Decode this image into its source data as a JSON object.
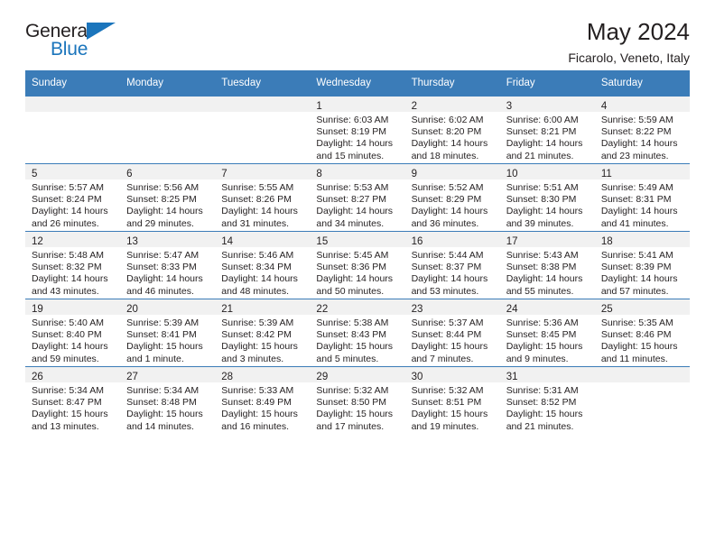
{
  "brand": {
    "word_one": "General",
    "word_two": "Blue",
    "flag_icon": "blue-triangle-flag",
    "accent_color": "#1b75bc"
  },
  "header": {
    "title": "May 2024",
    "location": "Ficarolo, Veneto, Italy"
  },
  "theme": {
    "header_blue": "#3b7cb8",
    "daynum_band": "#f1f1f1",
    "text": "#231f20"
  },
  "calendar": {
    "weekday_headers": [
      "Sunday",
      "Monday",
      "Tuesday",
      "Wednesday",
      "Thursday",
      "Friday",
      "Saturday"
    ],
    "labels": {
      "sunrise": "Sunrise:",
      "sunset": "Sunset:",
      "daylight": "Daylight:"
    },
    "weeks": [
      [
        {
          "day": ""
        },
        {
          "day": ""
        },
        {
          "day": ""
        },
        {
          "day": "1",
          "sunrise": "Sunrise: 6:03 AM",
          "sunset": "Sunset: 8:19 PM",
          "daylight1": "Daylight: 14 hours",
          "daylight2": "and 15 minutes."
        },
        {
          "day": "2",
          "sunrise": "Sunrise: 6:02 AM",
          "sunset": "Sunset: 8:20 PM",
          "daylight1": "Daylight: 14 hours",
          "daylight2": "and 18 minutes."
        },
        {
          "day": "3",
          "sunrise": "Sunrise: 6:00 AM",
          "sunset": "Sunset: 8:21 PM",
          "daylight1": "Daylight: 14 hours",
          "daylight2": "and 21 minutes."
        },
        {
          "day": "4",
          "sunrise": "Sunrise: 5:59 AM",
          "sunset": "Sunset: 8:22 PM",
          "daylight1": "Daylight: 14 hours",
          "daylight2": "and 23 minutes."
        }
      ],
      [
        {
          "day": "5",
          "sunrise": "Sunrise: 5:57 AM",
          "sunset": "Sunset: 8:24 PM",
          "daylight1": "Daylight: 14 hours",
          "daylight2": "and 26 minutes."
        },
        {
          "day": "6",
          "sunrise": "Sunrise: 5:56 AM",
          "sunset": "Sunset: 8:25 PM",
          "daylight1": "Daylight: 14 hours",
          "daylight2": "and 29 minutes."
        },
        {
          "day": "7",
          "sunrise": "Sunrise: 5:55 AM",
          "sunset": "Sunset: 8:26 PM",
          "daylight1": "Daylight: 14 hours",
          "daylight2": "and 31 minutes."
        },
        {
          "day": "8",
          "sunrise": "Sunrise: 5:53 AM",
          "sunset": "Sunset: 8:27 PM",
          "daylight1": "Daylight: 14 hours",
          "daylight2": "and 34 minutes."
        },
        {
          "day": "9",
          "sunrise": "Sunrise: 5:52 AM",
          "sunset": "Sunset: 8:29 PM",
          "daylight1": "Daylight: 14 hours",
          "daylight2": "and 36 minutes."
        },
        {
          "day": "10",
          "sunrise": "Sunrise: 5:51 AM",
          "sunset": "Sunset: 8:30 PM",
          "daylight1": "Daylight: 14 hours",
          "daylight2": "and 39 minutes."
        },
        {
          "day": "11",
          "sunrise": "Sunrise: 5:49 AM",
          "sunset": "Sunset: 8:31 PM",
          "daylight1": "Daylight: 14 hours",
          "daylight2": "and 41 minutes."
        }
      ],
      [
        {
          "day": "12",
          "sunrise": "Sunrise: 5:48 AM",
          "sunset": "Sunset: 8:32 PM",
          "daylight1": "Daylight: 14 hours",
          "daylight2": "and 43 minutes."
        },
        {
          "day": "13",
          "sunrise": "Sunrise: 5:47 AM",
          "sunset": "Sunset: 8:33 PM",
          "daylight1": "Daylight: 14 hours",
          "daylight2": "and 46 minutes."
        },
        {
          "day": "14",
          "sunrise": "Sunrise: 5:46 AM",
          "sunset": "Sunset: 8:34 PM",
          "daylight1": "Daylight: 14 hours",
          "daylight2": "and 48 minutes."
        },
        {
          "day": "15",
          "sunrise": "Sunrise: 5:45 AM",
          "sunset": "Sunset: 8:36 PM",
          "daylight1": "Daylight: 14 hours",
          "daylight2": "and 50 minutes."
        },
        {
          "day": "16",
          "sunrise": "Sunrise: 5:44 AM",
          "sunset": "Sunset: 8:37 PM",
          "daylight1": "Daylight: 14 hours",
          "daylight2": "and 53 minutes."
        },
        {
          "day": "17",
          "sunrise": "Sunrise: 5:43 AM",
          "sunset": "Sunset: 8:38 PM",
          "daylight1": "Daylight: 14 hours",
          "daylight2": "and 55 minutes."
        },
        {
          "day": "18",
          "sunrise": "Sunrise: 5:41 AM",
          "sunset": "Sunset: 8:39 PM",
          "daylight1": "Daylight: 14 hours",
          "daylight2": "and 57 minutes."
        }
      ],
      [
        {
          "day": "19",
          "sunrise": "Sunrise: 5:40 AM",
          "sunset": "Sunset: 8:40 PM",
          "daylight1": "Daylight: 14 hours",
          "daylight2": "and 59 minutes."
        },
        {
          "day": "20",
          "sunrise": "Sunrise: 5:39 AM",
          "sunset": "Sunset: 8:41 PM",
          "daylight1": "Daylight: 15 hours",
          "daylight2": "and 1 minute."
        },
        {
          "day": "21",
          "sunrise": "Sunrise: 5:39 AM",
          "sunset": "Sunset: 8:42 PM",
          "daylight1": "Daylight: 15 hours",
          "daylight2": "and 3 minutes."
        },
        {
          "day": "22",
          "sunrise": "Sunrise: 5:38 AM",
          "sunset": "Sunset: 8:43 PM",
          "daylight1": "Daylight: 15 hours",
          "daylight2": "and 5 minutes."
        },
        {
          "day": "23",
          "sunrise": "Sunrise: 5:37 AM",
          "sunset": "Sunset: 8:44 PM",
          "daylight1": "Daylight: 15 hours",
          "daylight2": "and 7 minutes."
        },
        {
          "day": "24",
          "sunrise": "Sunrise: 5:36 AM",
          "sunset": "Sunset: 8:45 PM",
          "daylight1": "Daylight: 15 hours",
          "daylight2": "and 9 minutes."
        },
        {
          "day": "25",
          "sunrise": "Sunrise: 5:35 AM",
          "sunset": "Sunset: 8:46 PM",
          "daylight1": "Daylight: 15 hours",
          "daylight2": "and 11 minutes."
        }
      ],
      [
        {
          "day": "26",
          "sunrise": "Sunrise: 5:34 AM",
          "sunset": "Sunset: 8:47 PM",
          "daylight1": "Daylight: 15 hours",
          "daylight2": "and 13 minutes."
        },
        {
          "day": "27",
          "sunrise": "Sunrise: 5:34 AM",
          "sunset": "Sunset: 8:48 PM",
          "daylight1": "Daylight: 15 hours",
          "daylight2": "and 14 minutes."
        },
        {
          "day": "28",
          "sunrise": "Sunrise: 5:33 AM",
          "sunset": "Sunset: 8:49 PM",
          "daylight1": "Daylight: 15 hours",
          "daylight2": "and 16 minutes."
        },
        {
          "day": "29",
          "sunrise": "Sunrise: 5:32 AM",
          "sunset": "Sunset: 8:50 PM",
          "daylight1": "Daylight: 15 hours",
          "daylight2": "and 17 minutes."
        },
        {
          "day": "30",
          "sunrise": "Sunrise: 5:32 AM",
          "sunset": "Sunset: 8:51 PM",
          "daylight1": "Daylight: 15 hours",
          "daylight2": "and 19 minutes."
        },
        {
          "day": "31",
          "sunrise": "Sunrise: 5:31 AM",
          "sunset": "Sunset: 8:52 PM",
          "daylight1": "Daylight: 15 hours",
          "daylight2": "and 21 minutes."
        },
        {
          "day": ""
        }
      ]
    ]
  }
}
